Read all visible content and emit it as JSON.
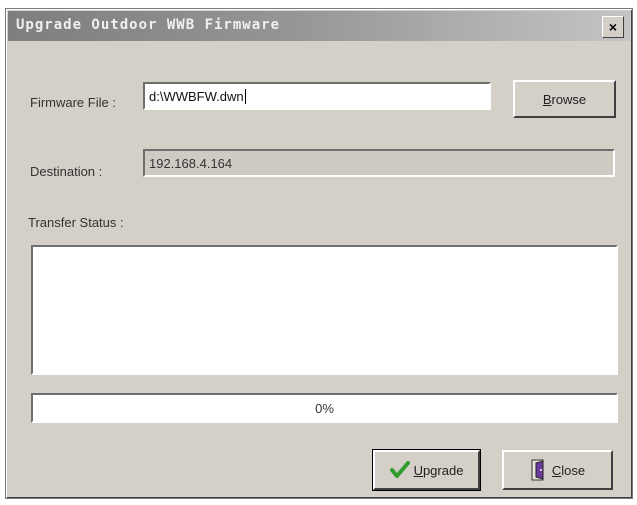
{
  "window": {
    "title": "Upgrade Outdoor WWB Firmware",
    "close_glyph": "×"
  },
  "firmware_file": {
    "label": "Firmware File :",
    "value": "d:\\WWBFW.dwn"
  },
  "browse_button": {
    "label_underlined": "B",
    "label_rest": "rowse"
  },
  "destination": {
    "label": "Destination :",
    "value": "192.168.4.164"
  },
  "transfer_status": {
    "label": "Transfer Status :",
    "log": ""
  },
  "progress": {
    "text": "0%",
    "fraction": 0
  },
  "upgrade_button": {
    "label_underlined": "U",
    "label_rest": "pgrade",
    "icon": "checkmark-icon",
    "icon_color": "#2f9e2f"
  },
  "close_button": {
    "label_underlined": "C",
    "label_rest": "lose",
    "icon": "door-exit-icon",
    "icon_color": "#6a3aa0"
  }
}
